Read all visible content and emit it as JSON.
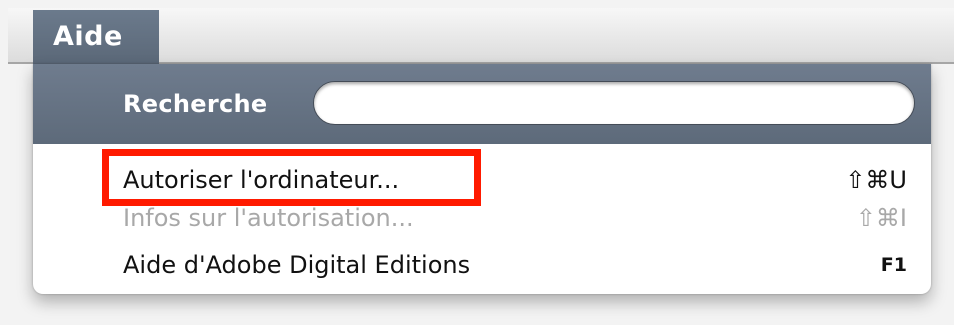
{
  "menubar": {
    "menu_title": "Aide"
  },
  "search": {
    "label": "Recherche",
    "value": "",
    "placeholder": ""
  },
  "menu": {
    "items": [
      {
        "label": "Autoriser l'ordinateur...",
        "shortcut": "⇧⌘U",
        "enabled": true,
        "highlighted": true
      },
      {
        "label": "Infos sur l'autorisation...",
        "shortcut": "⇧⌘I",
        "enabled": false
      },
      {
        "label": "Aide d'Adobe Digital Editions",
        "shortcut": "F1",
        "enabled": true
      }
    ]
  },
  "colors": {
    "header_bg": "#66737f",
    "highlight_border": "#ff1a00",
    "disabled_text": "#a8a8a8"
  }
}
